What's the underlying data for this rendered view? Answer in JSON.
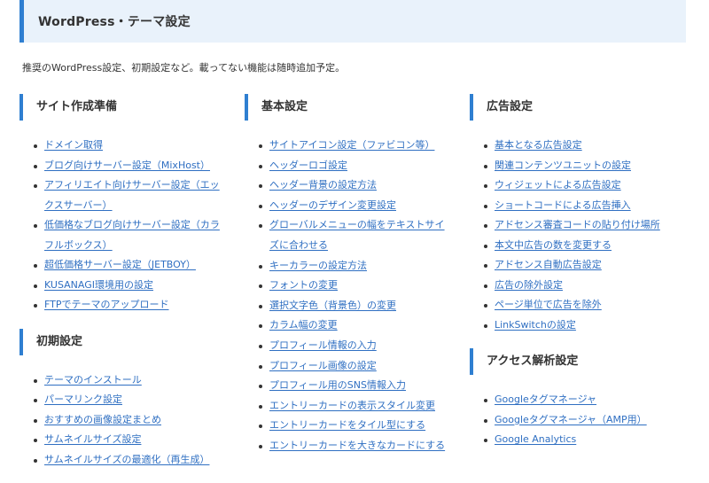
{
  "header": {
    "title": "WordPress・テーマ設定"
  },
  "intro": "推奨のWordPress設定、初期設定など。載ってない機能は随時追加予定。",
  "colors": {
    "accent": "#2f7fd1",
    "header_bg": "#e9f2fb",
    "link": "#2f6fc2"
  },
  "columns": [
    {
      "sections": [
        {
          "title": "サイト作成準備",
          "links": [
            "ドメイン取得",
            "ブログ向けサーバー設定（MixHost）",
            "アフィリエイト向けサーバー設定（エックスサーバー）",
            "低価格なブログ向けサーバー設定（カラフルボックス）",
            "超低価格サーバー設定（JETBOY）",
            "KUSANAGI環境用の設定",
            "FTPでテーマのアップロード"
          ]
        },
        {
          "title": "初期設定",
          "links": [
            "テーマのインストール",
            "パーマリンク設定",
            "おすすめの画像設定まとめ",
            "サムネイルサイズ設定",
            "サムネイルサイズの最適化（再生成）"
          ]
        }
      ]
    },
    {
      "sections": [
        {
          "title": "基本設定",
          "links": [
            "サイトアイコン設定（ファビコン等）",
            "ヘッダーロゴ設定",
            "ヘッダー背景の設定方法",
            "ヘッダーのデザイン変更設定",
            "グローバルメニューの幅をテキストサイズに合わせる",
            "キーカラーの設定方法",
            "フォントの変更",
            "選択文字色（背景色）の変更",
            "カラム幅の変更",
            "プロフィール情報の入力",
            "プロフィール画像の設定",
            "プロフィール用のSNS情報入力",
            "エントリーカードの表示スタイル変更",
            "エントリーカードをタイル型にする",
            "エントリーカードを大きなカードにする"
          ]
        }
      ]
    },
    {
      "sections": [
        {
          "title": "広告設定",
          "links": [
            "基本となる広告設定",
            "関連コンテンツユニットの設定",
            "ウィジェットによる広告設定",
            "ショートコードによる広告挿入",
            "アドセンス審査コードの貼り付け場所",
            "本文中広告の数を変更する",
            "アドセンス自動広告設定",
            "広告の除外設定",
            "ページ単位で広告を除外",
            "LinkSwitchの設定"
          ]
        },
        {
          "title": "アクセス解析設定",
          "links": [
            "Googleタグマネージャ",
            "Googleタグマネージャ（AMP用）",
            "Google Analytics"
          ]
        }
      ]
    }
  ]
}
